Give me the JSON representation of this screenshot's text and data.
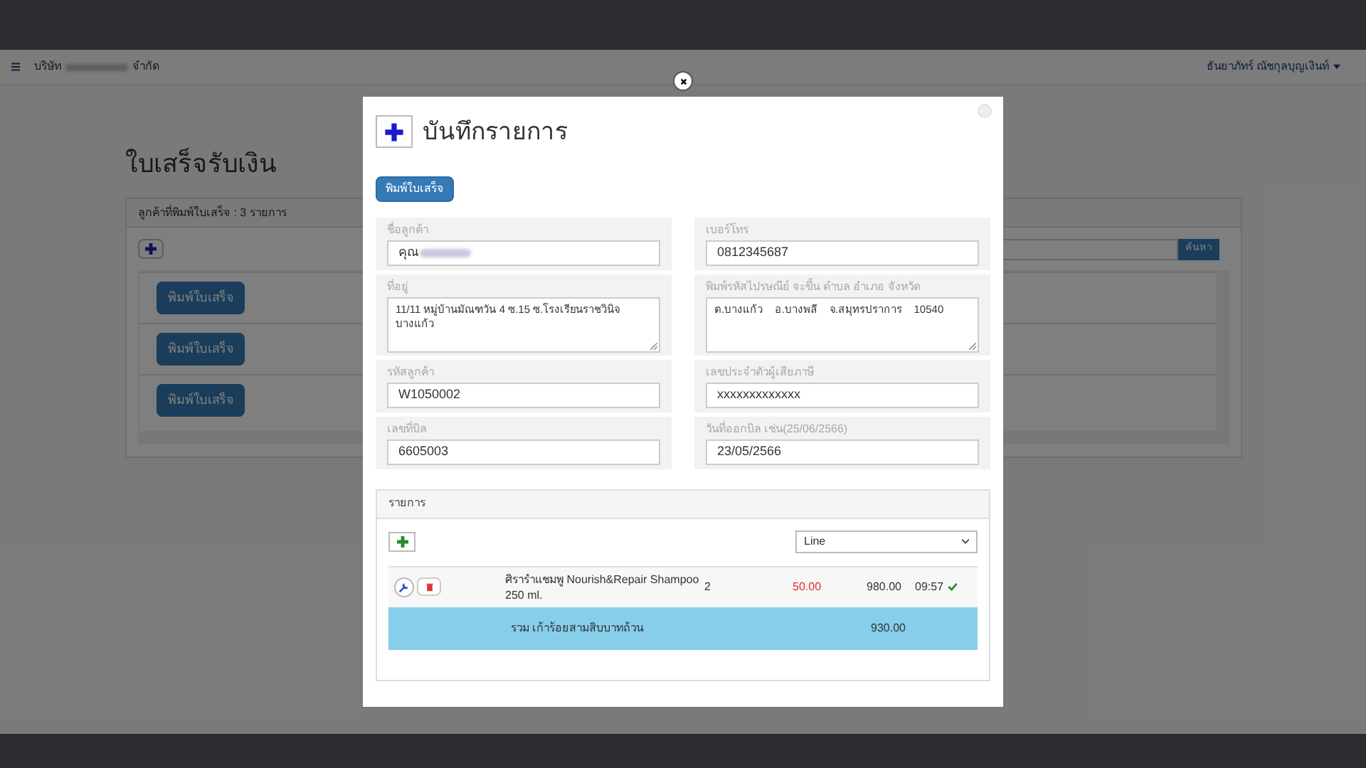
{
  "navbar": {
    "company_prefix": "บริษัท",
    "company_suffix": "จำกัด",
    "user": "ธันยาภัทร์ ณัชกุลบุญเงินท์"
  },
  "page": {
    "title": "ใบเสร็จรับเงิน",
    "panel_title": "ลูกค้าที่พิมพ์ใบเสร็จ : 3 รายการ",
    "search_button": "ค้นหา",
    "rows": [
      {
        "button": "พิมพ์ใบเสร็จ"
      },
      {
        "button": "พิมพ์ใบเสร็จ"
      },
      {
        "button": "พิมพ์ใบเสร็จ"
      }
    ]
  },
  "modal": {
    "title": "บันทึกรายการ",
    "print_button": "พิมพ์ใบเสร็จ",
    "fields": [
      {
        "label": "ชื่อลูกค้า",
        "value": "คุณ",
        "kind": "input",
        "blurred": true
      },
      {
        "label": "เบอร์โทร",
        "value": "0812345687",
        "kind": "input"
      },
      {
        "label": "ที่อยู่",
        "value": "11/11 หมู่บ้านมัณฑวัน 4 ซ.15 ซ.โรงเรียนราชวินิจบางแก้ว",
        "kind": "textarea"
      },
      {
        "label": "พิมพ์รหัสไปรษณีย์ จะขึ้น ตำบล อำเภอ จังหวัด",
        "value": "ต.บางแก้ว    อ.บางพลี    จ.สมุทรปราการ    10540",
        "kind": "textarea"
      },
      {
        "label": "รหัสลูกค้า",
        "value": "W1050002",
        "kind": "input"
      },
      {
        "label": "เลขประจำตัวผู้เสียภาษี",
        "value": "xxxxxxxxxxxxx",
        "kind": "input"
      },
      {
        "label": "เลขที่บิล",
        "value": "6605003",
        "kind": "input"
      },
      {
        "label": "วันที่ออกบิล เช่น(25/06/2566)",
        "value": "23/05/2566",
        "kind": "input"
      }
    ],
    "items": {
      "title": "รายการ",
      "select": "Line",
      "rows": [
        {
          "name": "ศิรารำแชมพู Nourish&Repair Shampoo 250 ml.",
          "qty": "2",
          "discount": "50.00",
          "amount": "980.00",
          "time": "09:57",
          "saved": true
        }
      ],
      "total_label": "รวม เก้าร้อยสามสิบบาทถ้วน",
      "total": "930.00"
    }
  }
}
